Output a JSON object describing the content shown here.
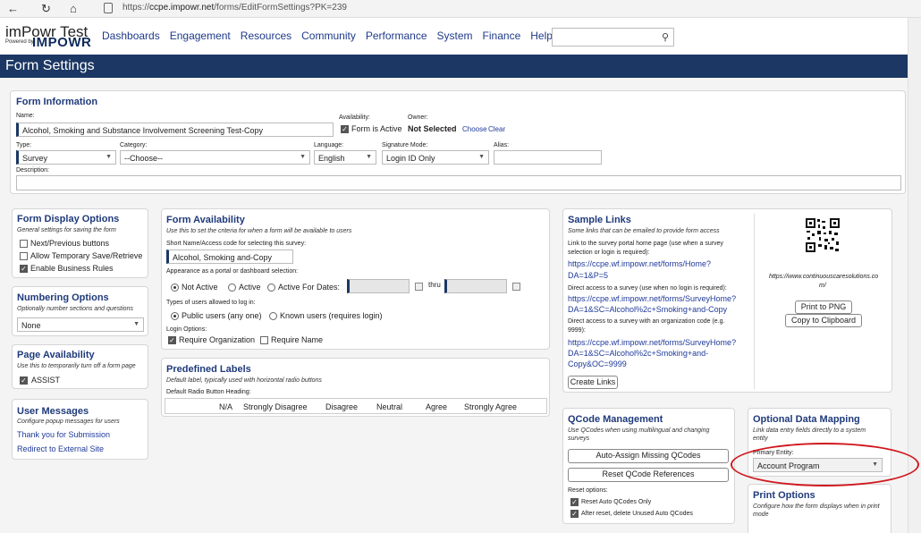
{
  "browser": {
    "url_prefix": "https://",
    "url_domain": "ccpe.impowr.net",
    "url_path": "/forms/EditFormSettings?PK=239"
  },
  "header": {
    "logo_title": "imPowr Test",
    "logo_powered": "Powered by",
    "logo_brand": "IMPOWR",
    "nav": [
      "Dashboards",
      "Engagement",
      "Resources",
      "Community",
      "Performance",
      "System",
      "Finance",
      "Help"
    ],
    "search_placeholder": ""
  },
  "page_title": "Form Settings",
  "form_info": {
    "title": "Form Information",
    "name_label": "Name:",
    "name_value": "Alcohol, Smoking and Substance Involvement Screening Test-Copy",
    "availability_label": "Availability:",
    "form_active_label": "Form is Active",
    "owner_label": "Owner:",
    "owner_value": "Not Selected",
    "choose": "Choose",
    "clear": "Clear",
    "type_label": "Type:",
    "type_value": "Survey",
    "category_label": "Category:",
    "category_value": "--Choose--",
    "language_label": "Language:",
    "language_value": "English",
    "signature_label": "Signature Mode:",
    "signature_value": "Login ID Only",
    "alias_label": "Alias:",
    "alias_value": "",
    "description_label": "Description:"
  },
  "display_options": {
    "title": "Form Display Options",
    "subtitle": "General settings for saving the form",
    "items": [
      {
        "label": "Next/Previous buttons",
        "checked": false
      },
      {
        "label": "Allow Temporary Save/Retrieve",
        "checked": false
      },
      {
        "label": "Enable Business Rules",
        "checked": true
      }
    ]
  },
  "numbering": {
    "title": "Numbering Options",
    "subtitle": "Optionally number sections and questions",
    "value": "None"
  },
  "page_availability": {
    "title": "Page Availability",
    "subtitle": "Use this to temporarily turn off a form page",
    "item": "ASSIST"
  },
  "user_messages": {
    "title": "User Messages",
    "subtitle": "Configure popup messages for users",
    "links": [
      "Thank you for Submission",
      "Redirect to External Site"
    ]
  },
  "form_availability": {
    "title": "Form Availability",
    "subtitle": "Use this to set the criteria for when a form will be available to users",
    "short_name_label": "Short Name/Access code for selecting this survey:",
    "short_name_value": "Alcohol, Smoking and-Copy",
    "appearance_label": "Appearance as a portal or dashboard selection:",
    "appearance_options": [
      "Not Active",
      "Active",
      "Active For Dates:"
    ],
    "thru": "thru",
    "login_types_label": "Types of users allowed to log in:",
    "login_types": [
      "Public users (any one)",
      "Known users (requires login)"
    ],
    "login_options_label": "Login Options:",
    "login_options": [
      "Require Organization",
      "Require Name"
    ]
  },
  "predefined_labels": {
    "title": "Predefined Labels",
    "subtitle": "Default label, typically used with horizontal radio buttons",
    "heading_label": "Default Radio Button Heading:",
    "columns": [
      "N/A",
      "Strongly Disagree",
      "Disagree",
      "Neutral",
      "Agree",
      "Strongly Agree"
    ]
  },
  "sample_links": {
    "title": "Sample Links",
    "subtitle": "Some links that can be emailed to provide form access",
    "desc1": [
      "Link to the survey portal home page (use when a survey",
      "selection or login is required):"
    ],
    "link1": [
      "https://ccpe.wf.impowr.net/forms/Home?",
      "DA=1&P=5"
    ],
    "desc2": "Direct access to a survey (use when no login is required):",
    "link2": [
      "https://ccpe.wf.impowr.net/forms/SurveyHome?",
      "DA=1&SC=Alcohol%2c+Smoking+and-Copy"
    ],
    "desc3": [
      "Direct access to a survey with an organization code (e.g.",
      "9999):"
    ],
    "link3": [
      "https://ccpe.wf.impowr.net/forms/SurveyHome?",
      "DA=1&SC=Alcohol%2c+Smoking+and-",
      "Copy&OC=9999"
    ],
    "create_links": "Create Links",
    "qr_url": [
      "https://www.continuouscaresolutions.co",
      "m/"
    ],
    "print_png": "Print to PNG",
    "copy_clipboard": "Copy to Clipboard"
  },
  "qcode": {
    "title": "QCode Management",
    "subtitle": [
      "Use QCodes when using multilingual and changing",
      "surveys"
    ],
    "auto_assign": "Auto-Assign Missing QCodes",
    "reset_refs": "Reset QCode References",
    "reset_options_label": "Reset options:",
    "options": [
      "Reset Auto QCodes Only",
      "After reset, delete Unused Auto QCodes"
    ]
  },
  "data_mapping": {
    "title": "Optional Data Mapping",
    "subtitle": [
      "Link data entry fields directly to a system",
      "entity"
    ],
    "primary_label": "Primary Entity:",
    "primary_value": "Account Program"
  },
  "print_options": {
    "title": "Print Options",
    "subtitle": [
      "Configure how the form displays when in print",
      "mode"
    ]
  },
  "colors": {
    "navy": "#1c3763",
    "link": "#1f3a9a",
    "highlight": "#d0191f"
  }
}
